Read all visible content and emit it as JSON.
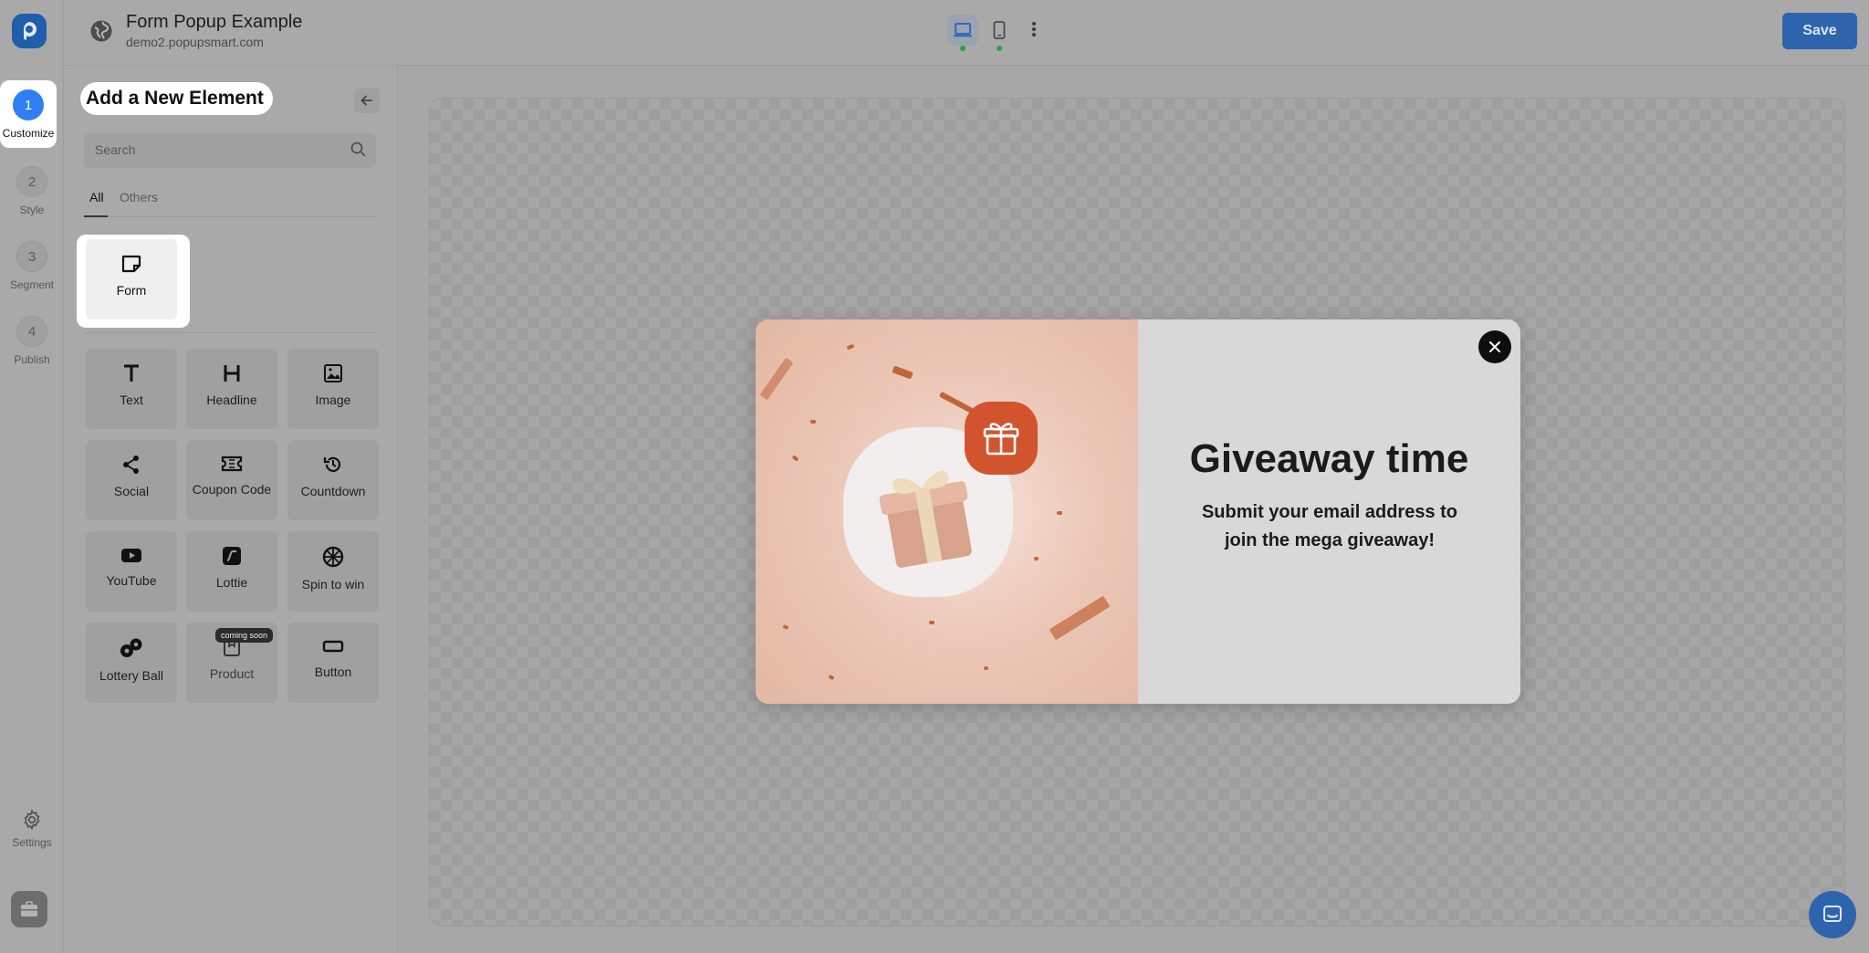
{
  "header": {
    "title": "Form Popup Example",
    "subtitle": "demo2.popupsmart.com",
    "save_label": "Save"
  },
  "steps": [
    {
      "num": "1",
      "label": "Customize",
      "active": true
    },
    {
      "num": "2",
      "label": "Style"
    },
    {
      "num": "3",
      "label": "Segment"
    },
    {
      "num": "4",
      "label": "Publish"
    }
  ],
  "rail": {
    "settings_label": "Settings"
  },
  "panel": {
    "title": "Add a New Element",
    "search_placeholder": "Search",
    "tabs": [
      {
        "label": "All",
        "active": true
      },
      {
        "label": "Others"
      }
    ],
    "form_tile": "Form",
    "tiles": [
      {
        "label": "Text",
        "icon": "text-icon"
      },
      {
        "label": "Headline",
        "icon": "headline-icon"
      },
      {
        "label": "Image",
        "icon": "image-icon"
      },
      {
        "label": "Social",
        "icon": "share-icon"
      },
      {
        "label": "Coupon Code",
        "icon": "ticket-icon"
      },
      {
        "label": "Countdown",
        "icon": "history-icon"
      },
      {
        "label": "YouTube",
        "icon": "youtube-icon"
      },
      {
        "label": "Lottie",
        "icon": "lottie-icon"
      },
      {
        "label": "Spin to win",
        "icon": "wheel-icon"
      },
      {
        "label": "Lottery Ball",
        "icon": "lottery-ball-icon"
      },
      {
        "label": "Product",
        "icon": "product-icon"
      },
      {
        "label": "Button",
        "icon": "button-icon"
      }
    ],
    "coming_soon": "coming soon"
  },
  "popup": {
    "title": "Giveaway time",
    "subtitle": "Submit your email address to join the mega giveaway!"
  },
  "colors": {
    "accent": "#2f7ff2",
    "save_button": "#2e64ad",
    "gift_badge": "#d2542e"
  }
}
